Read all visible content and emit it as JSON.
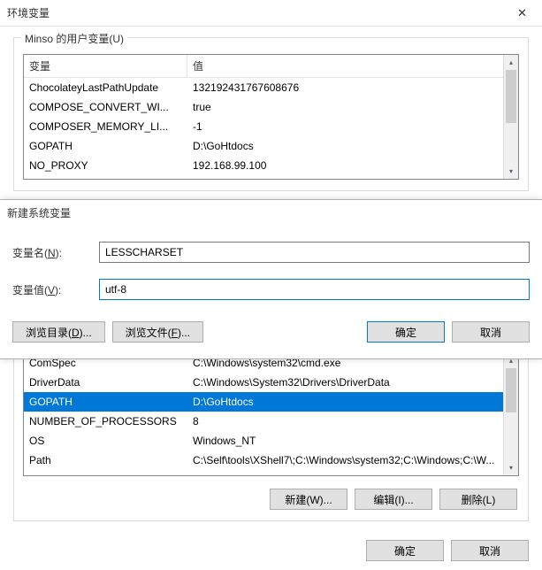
{
  "window": {
    "title": "环境变量",
    "close": "✕"
  },
  "userVars": {
    "groupLabel": "Minso 的用户变量(U)",
    "headers": {
      "name": "变量",
      "value": "值"
    },
    "rows": [
      {
        "name": "ChocolateyLastPathUpdate",
        "value": "132192431767608676"
      },
      {
        "name": "COMPOSE_CONVERT_WI...",
        "value": "true"
      },
      {
        "name": "COMPOSER_MEMORY_LI...",
        "value": "-1"
      },
      {
        "name": "GOPATH",
        "value": "D:\\GoHtdocs"
      },
      {
        "name": "NO_PROXY",
        "value": "192.168.99.100"
      }
    ]
  },
  "dialog": {
    "title": "新建系统变量",
    "nameLabel": "变量名(",
    "nameKey": "N",
    "nameLabelEnd": "):",
    "nameValue": "LESSCHARSET",
    "valueLabel": "变量值(",
    "valueKey": "V",
    "valueLabelEnd": "):",
    "valueValue": "utf-8",
    "browseDir": "浏览目录(",
    "browseDirKey": "D",
    "browseDirEnd": ")...",
    "browseFile": "浏览文件(",
    "browseFileKey": "F",
    "browseFileEnd": ")...",
    "ok": "确定",
    "cancel": "取消"
  },
  "sysVars": {
    "rows": [
      {
        "name": "ComSpec",
        "value": "C:\\Windows\\system32\\cmd.exe"
      },
      {
        "name": "DriverData",
        "value": "C:\\Windows\\System32\\Drivers\\DriverData"
      },
      {
        "name": "GOPATH",
        "value": "D:\\GoHtdocs"
      },
      {
        "name": "NUMBER_OF_PROCESSORS",
        "value": "8"
      },
      {
        "name": "OS",
        "value": "Windows_NT"
      },
      {
        "name": "Path",
        "value": "C:\\Self\\tools\\XShell7\\;C:\\Windows\\system32;C:\\Windows;C:\\W..."
      }
    ],
    "new": "新建(W)...",
    "edit": "编辑(I)...",
    "delete": "删除(L)"
  },
  "footer": {
    "ok": "确定",
    "cancel": "取消"
  }
}
